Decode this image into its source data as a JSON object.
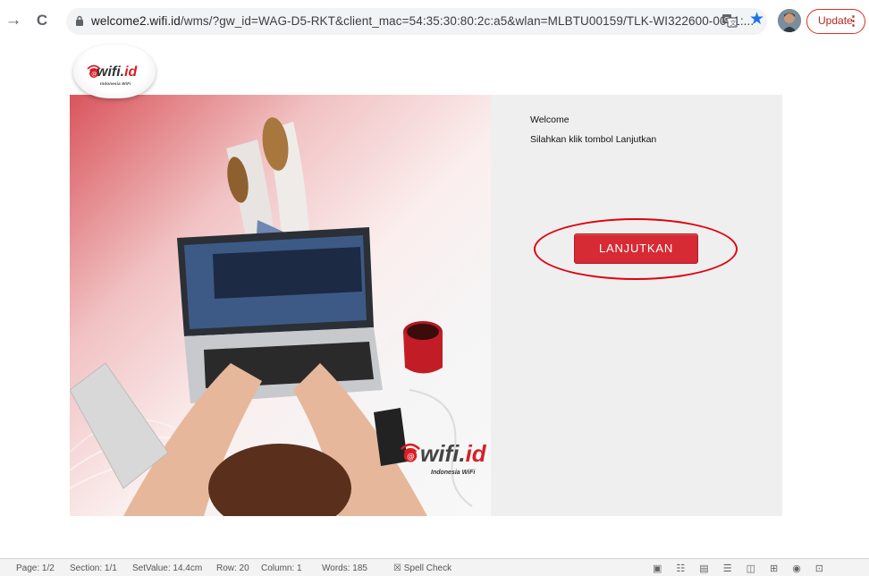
{
  "browser": {
    "back_glyph": "→",
    "reload_glyph": "C",
    "url_host": "welcome2.wifi.id",
    "url_rest": "/wms/?gw_id=WAG-D5-RKT&client_mac=54:35:30:80:2c:a5&wlan=MLBTU00159/TLK-WI322600-0001:...",
    "update_label": "Update",
    "menu_glyph": "⋮",
    "icons": [
      "arrow-icon",
      "reload-icon",
      "lock-icon",
      "translate-icon",
      "star-icon",
      "avatar",
      "menu-icon"
    ]
  },
  "logo": {
    "brand_prefix": "wifi.",
    "brand_suffix": "id",
    "tagline": "Indonesia WiFi"
  },
  "hero_logo": {
    "brand_prefix": "wifi.",
    "brand_suffix": "id",
    "tagline": "Indonesia WiFi"
  },
  "panel": {
    "welcome": "Welcome",
    "instruction": "Silahkan klik tombol Lanjutkan",
    "button_label": "LANJUTKAN"
  },
  "statusbar": {
    "page": "Page: 1/2",
    "section": "Section: 1/1",
    "setvalue": "SetValue: 14.4cm",
    "row": "Row: 20",
    "column": "Column: 1",
    "words": "Words: 185",
    "spell": "Spell Check"
  },
  "colors": {
    "accent_red": "#d62a34",
    "highlight": "#e1000f",
    "panel_bg": "#efefef",
    "star_blue": "#1a73e8"
  }
}
